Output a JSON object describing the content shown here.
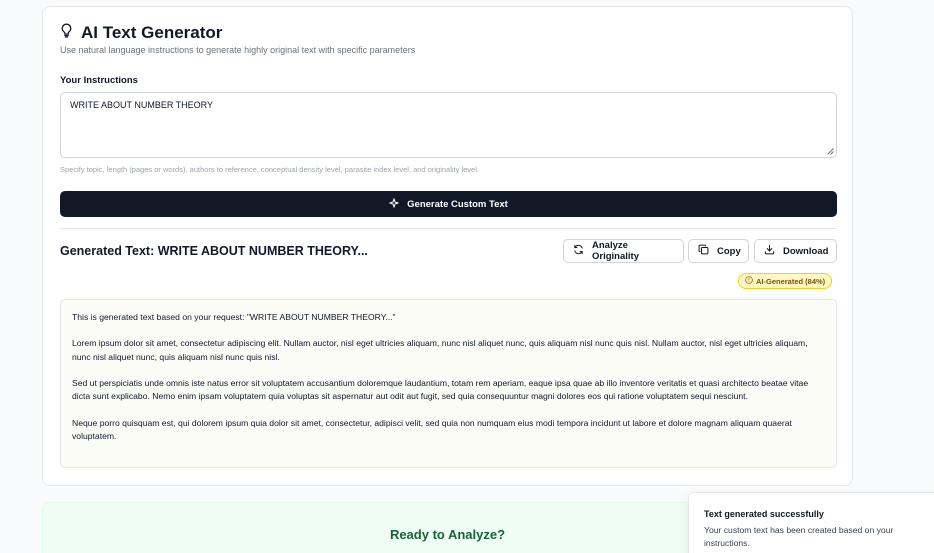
{
  "header": {
    "title": "AI Text Generator",
    "subtitle": "Use natural language instructions to generate highly original text with specific parameters",
    "icon": "lightbulb-icon"
  },
  "instructions": {
    "label": "Your Instructions",
    "value": "WRITE ABOUT NUMBER THEORY",
    "hint": "Specify topic, length (pages or words), authors to reference, conceptual density level, parasite index level, and originality level."
  },
  "generate_button": {
    "label": "Generate Custom Text",
    "icon": "sparkle-icon"
  },
  "generated": {
    "title": "Generated Text: WRITE ABOUT NUMBER THEORY...",
    "analyze_label": "Analyze Originality",
    "copy_label": "Copy",
    "download_label": "Download",
    "badge": "AI-Generated (84%)",
    "badge_color": "#fef9c3",
    "paragraphs": [
      "This is generated text based on your request: \"WRITE ABOUT NUMBER THEORY...\"",
      "Lorem ipsum dolor sit amet, consectetur adipiscing elit. Nullam auctor, nisl eget ultricies aliquam, nunc nisl aliquet nunc, quis aliquam nisl nunc quis nisl. Nullam auctor, nisl eget ultricies aliquam, nunc nisl aliquet nunc, quis aliquam nisl nunc quis nisl.",
      "Sed ut perspiciatis unde omnis iste natus error sit voluptatem accusantium doloremque laudantium, totam rem aperiam, eaque ipsa quae ab illo inventore veritatis et quasi architecto beatae vitae dicta sunt explicabo. Nemo enim ipsam voluptatem quia voluptas sit aspernatur aut odit aut fugit, sed quia consequuntur magni dolores eos qui ratione voluptatem sequi nesciunt.",
      "Neque porro quisquam est, qui dolorem ipsum quia dolor sit amet, consectetur, adipisci velit, sed quia non numquam eius modi tempora incidunt ut labore et dolore magnam aliquam quaerat voluptatem."
    ]
  },
  "ready": {
    "title": "Ready to Analyze?"
  },
  "toast": {
    "title": "Text generated successfully",
    "message": "Your custom text has been created based on your instructions."
  },
  "colors": {
    "primary": "#111827",
    "accent_green": "#166534"
  }
}
